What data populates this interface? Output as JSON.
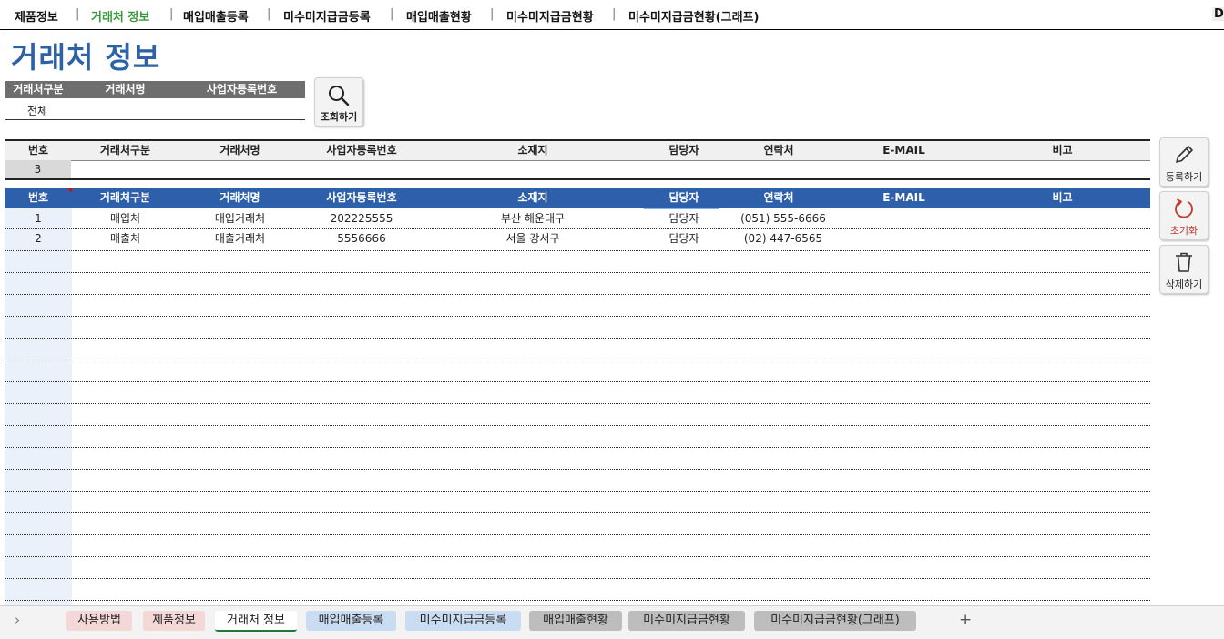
{
  "nav": {
    "items": [
      "제품정보",
      "거래처 정보",
      "매입매출등록",
      "미수미지급금등록",
      "매입매출현황",
      "미수미지급금현황",
      "미수미지급금현황(그래프)"
    ],
    "active_index": 1,
    "right_edge_text": "DI"
  },
  "page": {
    "title": "거래처 정보"
  },
  "filter": {
    "headers": [
      "거래처구분",
      "거래처명",
      "사업자등록번호"
    ],
    "type_value": "전체",
    "search_button": "조회하기"
  },
  "input_table": {
    "headers": [
      "번호",
      "거래처구분",
      "거래처명",
      "사업자등록번호",
      "소재지",
      "담당자",
      "연락처",
      "E-MAIL",
      "비고"
    ],
    "next_number": "3"
  },
  "list_table": {
    "headers": [
      "번호",
      "거래처구분",
      "거래처명",
      "사업자등록번호",
      "소재지",
      "담당자",
      "연락처",
      "E-MAIL",
      "비고"
    ],
    "rows": [
      {
        "no": "1",
        "type": "매입처",
        "name": "매입거래처",
        "biz": "202225555",
        "addr": "부산 해운대구",
        "manager": "담당자",
        "phone": "(051) 555-6666",
        "email": "",
        "note": ""
      },
      {
        "no": "2",
        "type": "매출처",
        "name": "매출거래처",
        "biz": "5556666",
        "addr": "서울 강서구",
        "manager": "담당자",
        "phone": "(02) 447-6565",
        "email": "",
        "note": ""
      }
    ]
  },
  "actions": {
    "register": "등록하기",
    "reset": "초기화",
    "delete": "삭제하기"
  },
  "sheet_tabs": [
    {
      "label": "사용방법",
      "color": "#f4d7d7"
    },
    {
      "label": "제품정보",
      "color": "#f4d7d7"
    },
    {
      "label": "거래처 정보",
      "color": "#ffffff"
    },
    {
      "label": "매입매출등록",
      "color": "#c9dcf2"
    },
    {
      "label": "미수미지급금등록",
      "color": "#c9dcf2"
    },
    {
      "label": "매입매출현황",
      "color": "#bdbdbd"
    },
    {
      "label": "미수미지급금현황",
      "color": "#bdbdbd"
    },
    {
      "label": "미수미지급금현황(그래프)",
      "color": "#bdbdbd"
    }
  ],
  "sheet_tabs_active": 2,
  "tab_controls": {
    "scroll_arrow": "›",
    "add_sheet": "+"
  },
  "colors": {
    "title": "#2e62a6",
    "header_bg": "#2e5faa",
    "nav_active": "#3a9a3a",
    "reset_accent": "#c0392b"
  }
}
